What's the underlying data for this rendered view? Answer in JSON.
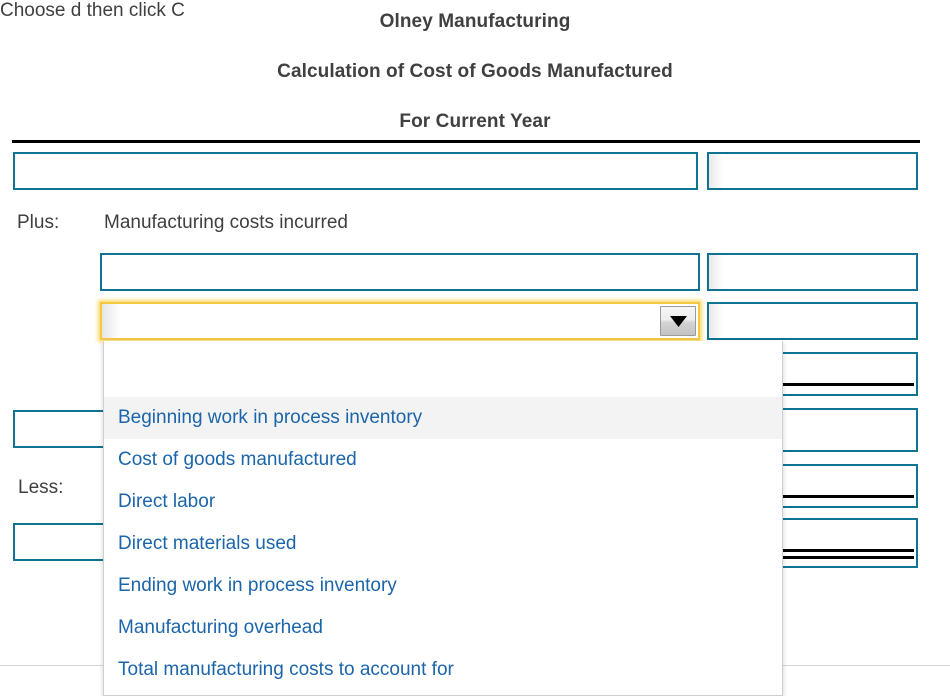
{
  "header": {
    "company": "Olney Manufacturing",
    "statement": "Calculation of Cost of Goods Manufactured",
    "period": "For Current Year"
  },
  "labels": {
    "plus": "Plus:",
    "plus_text": "Manufacturing costs incurred",
    "less": "Less:",
    "instructions": "Choose                                                          d then click C"
  },
  "select": {
    "name": "account-select",
    "value": "",
    "placeholder": "",
    "state": "open-focused",
    "arrow_icon": "chevron-down-icon",
    "focus_color": "#f4c842"
  },
  "dropdown": {
    "options": [
      {
        "label": "",
        "blank": true,
        "highlighted": false
      },
      {
        "label": "Beginning work in process inventory",
        "blank": false,
        "highlighted": true
      },
      {
        "label": "Cost of goods manufactured",
        "blank": false,
        "highlighted": false
      },
      {
        "label": "Direct labor",
        "blank": false,
        "highlighted": false
      },
      {
        "label": "Direct materials used",
        "blank": false,
        "highlighted": false
      },
      {
        "label": "Ending work in process inventory",
        "blank": false,
        "highlighted": false
      },
      {
        "label": "Manufacturing overhead",
        "blank": false,
        "highlighted": false
      },
      {
        "label": "Total manufacturing costs to account for",
        "blank": false,
        "highlighted": false
      }
    ],
    "option_text_color": "#1b65aa",
    "highlight_color": "#f3f3f3"
  },
  "cells": {
    "border_color": "#0f7391",
    "left_column": [
      {
        "name": "account-row-1",
        "value": ""
      },
      {
        "name": "account-row-2",
        "value": ""
      },
      {
        "name": "account-row-5",
        "value": ""
      },
      {
        "name": "account-row-7",
        "value": ""
      }
    ],
    "right_column": [
      {
        "name": "amount-row-1",
        "value": "",
        "rule": "none"
      },
      {
        "name": "amount-row-2",
        "value": "",
        "rule": "none"
      },
      {
        "name": "amount-row-3",
        "value": "",
        "rule": "none"
      },
      {
        "name": "amount-row-4",
        "value": "",
        "rule": "single"
      },
      {
        "name": "amount-row-5",
        "value": "",
        "rule": "none"
      },
      {
        "name": "amount-row-6",
        "value": "",
        "rule": "single"
      },
      {
        "name": "amount-row-7",
        "value": "",
        "rule": "double"
      }
    ]
  }
}
